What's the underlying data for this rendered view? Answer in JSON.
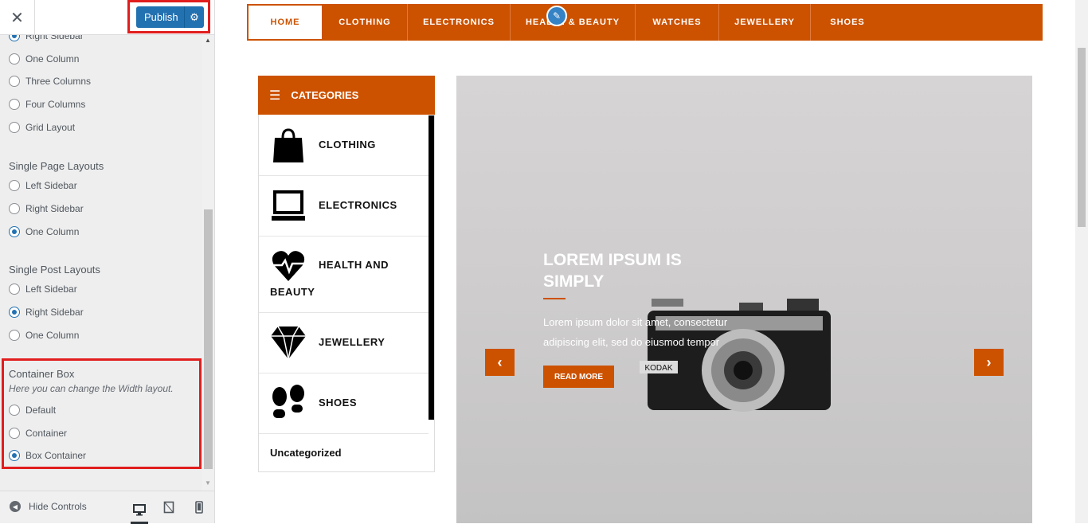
{
  "sidebar": {
    "close_icon": "close-icon",
    "publish_label": "Publish",
    "publish_settings_icon": "gear-icon",
    "archive_layouts": {
      "options": [
        {
          "label": "Right Sidebar",
          "checked": true
        },
        {
          "label": "One Column",
          "checked": false
        },
        {
          "label": "Three Columns",
          "checked": false
        },
        {
          "label": "Four Columns",
          "checked": false
        },
        {
          "label": "Grid Layout",
          "checked": false
        }
      ]
    },
    "single_page_layouts": {
      "title": "Single Page Layouts",
      "options": [
        {
          "label": "Left Sidebar",
          "checked": false
        },
        {
          "label": "Right Sidebar",
          "checked": false
        },
        {
          "label": "One Column",
          "checked": true
        }
      ]
    },
    "single_post_layouts": {
      "title": "Single Post Layouts",
      "options": [
        {
          "label": "Left Sidebar",
          "checked": false
        },
        {
          "label": "Right Sidebar",
          "checked": true
        },
        {
          "label": "One Column",
          "checked": false
        }
      ]
    },
    "container_box": {
      "title": "Container Box",
      "description": "Here you can change the Width layout.",
      "options": [
        {
          "label": "Default",
          "checked": false
        },
        {
          "label": "Container",
          "checked": false
        },
        {
          "label": "Box Container",
          "checked": true
        }
      ]
    },
    "footer": {
      "hide_controls_label": "Hide Controls",
      "devices": [
        "desktop-icon",
        "tablet-icon",
        "mobile-icon"
      ],
      "active_device": "desktop"
    }
  },
  "preview": {
    "menu": [
      "HOME",
      "CLOTHING",
      "ELECTRONICS",
      "HEALTH & BEAUTY",
      "WATCHES",
      "JEWELLERY",
      "SHOES"
    ],
    "active_menu": "HOME",
    "categories_title": "CATEGORIES",
    "categories": [
      {
        "label": "CLOTHING",
        "icon": "shopping-bag-icon"
      },
      {
        "label": "ELECTRONICS",
        "icon": "laptop-icon"
      },
      {
        "label": "HEALTH AND",
        "label2": "BEAUTY",
        "icon": "heartbeat-icon"
      },
      {
        "label": "JEWELLERY",
        "icon": "diamond-icon"
      },
      {
        "label": "SHOES",
        "icon": "footprints-icon"
      },
      {
        "label": "Uncategorized",
        "icon": ""
      }
    ],
    "slide": {
      "title": "LOREM IPSUM IS SIMPLY",
      "text": "Lorem ipsum dolor sit amet, consectetur adipiscing elit, sed do eiusmod tempor",
      "button": "READ MORE",
      "camera_brand": "KODAK"
    }
  },
  "colors": {
    "accent": "#cc5200",
    "wp_blue": "#2271b1",
    "highlight_red": "#e11d1d"
  }
}
